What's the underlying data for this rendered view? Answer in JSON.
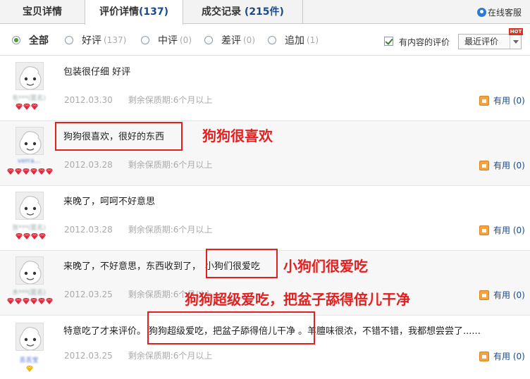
{
  "tabs": [
    {
      "label": "宝贝详情",
      "count": ""
    },
    {
      "label": "评价详情",
      "count": "(137)"
    },
    {
      "label": "成交记录",
      "count": "(215件)"
    }
  ],
  "service_label": "在线客服",
  "filters": [
    {
      "label": "全部",
      "count": "",
      "selected": true
    },
    {
      "label": "好评",
      "count": "(137)",
      "selected": false
    },
    {
      "label": "中评",
      "count": "(0)",
      "selected": false
    },
    {
      "label": "差评",
      "count": "(0)",
      "selected": false
    },
    {
      "label": "追加",
      "count": "(1)",
      "selected": false
    }
  ],
  "has_content_label": "有内容的评价",
  "has_content_checked": true,
  "sort": {
    "value": "最近评价",
    "badge": "HOT"
  },
  "reviews": [
    {
      "user": "毛***(匿名)",
      "content": "包装很仔细 好评",
      "date": "2012.03.30",
      "warranty": "剩余保质期:6个月以上",
      "useful": "有用",
      "useful_count": "(0)"
    },
    {
      "user": "verra...",
      "content": "狗狗很喜欢，很好的东西",
      "date": "2012.03.28",
      "warranty": "剩余保质期:6个月以上",
      "useful": "有用",
      "useful_count": "(0)"
    },
    {
      "user": "张***(匿名)",
      "content": "来晚了，呵呵不好意思",
      "date": "2012.03.28",
      "warranty": "剩余保质期:6个月以上",
      "useful": "有用",
      "useful_count": "(0)"
    },
    {
      "user": "木***(匿名)",
      "content_a": "来晚了，不好意思，东西收到了，",
      "content_b": "小狗们很爱吃",
      "date": "2012.03.25",
      "warranty": "剩余保质期:6个月以上",
      "useful": "有用",
      "useful_count": "(0)"
    },
    {
      "user": "丢丢宝",
      "content_a": "特意吃了才来评价。",
      "content_b": "狗狗超级爱吃，把盆子舔得倍儿干净",
      "content_c": "。羊膻味很浓，不错不错，我都想尝尝了......",
      "date": "2012.03.25",
      "warranty": "剩余保质期:6个月以上",
      "useful": "有用",
      "useful_count": "(0)"
    }
  ],
  "annotations": [
    "狗狗很喜欢",
    "小狗们很爱吃",
    "狗狗超级爱吃，把盆子舔得倍儿干净"
  ],
  "colors": {
    "accent": "#e32020",
    "link": "#1a4a8a",
    "gem": "#e0283a"
  }
}
